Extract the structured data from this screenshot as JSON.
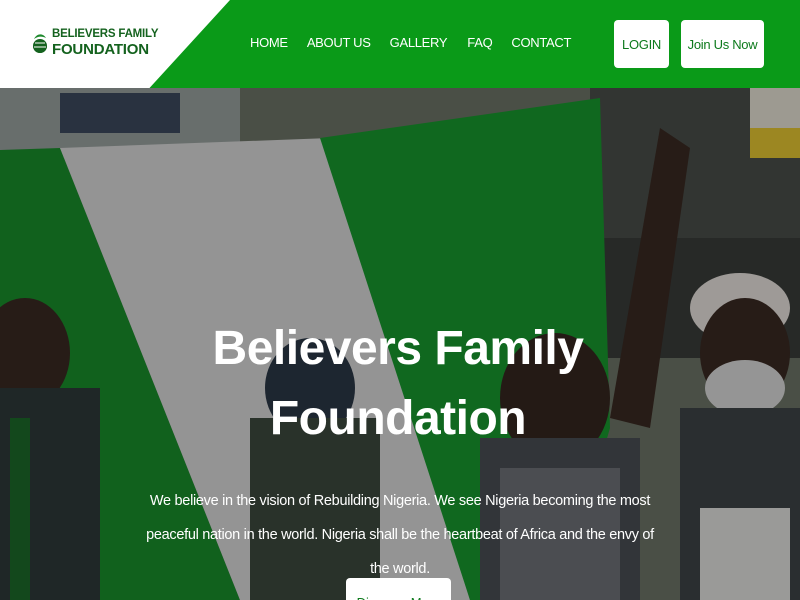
{
  "brand": {
    "line1": "BELIEVERS FAMILY",
    "line2": "FOUNDATION",
    "logo_icon": "leaf-globe-icon"
  },
  "nav": {
    "items": [
      {
        "label": "HOME"
      },
      {
        "label": "ABOUT US"
      },
      {
        "label": "GALLERY"
      },
      {
        "label": "FAQ"
      },
      {
        "label": "CONTACT"
      }
    ]
  },
  "header_buttons": {
    "login": "LOGIN",
    "join": "Join Us Now"
  },
  "hero": {
    "title_line1": "Believers Family",
    "title_line2": "Foundation",
    "description": "We believe in the vision of Rebuilding Nigeria. We see Nigeria becoming the most peaceful nation in the world. Nigeria shall be the heartbeat of Africa and the envy of the world.",
    "cta_label": "Discover More",
    "background": "photo of people holding a Nigerian flag"
  },
  "colors": {
    "brand_green": "#0a9a18",
    "logo_green": "#14621e",
    "white": "#ffffff"
  }
}
